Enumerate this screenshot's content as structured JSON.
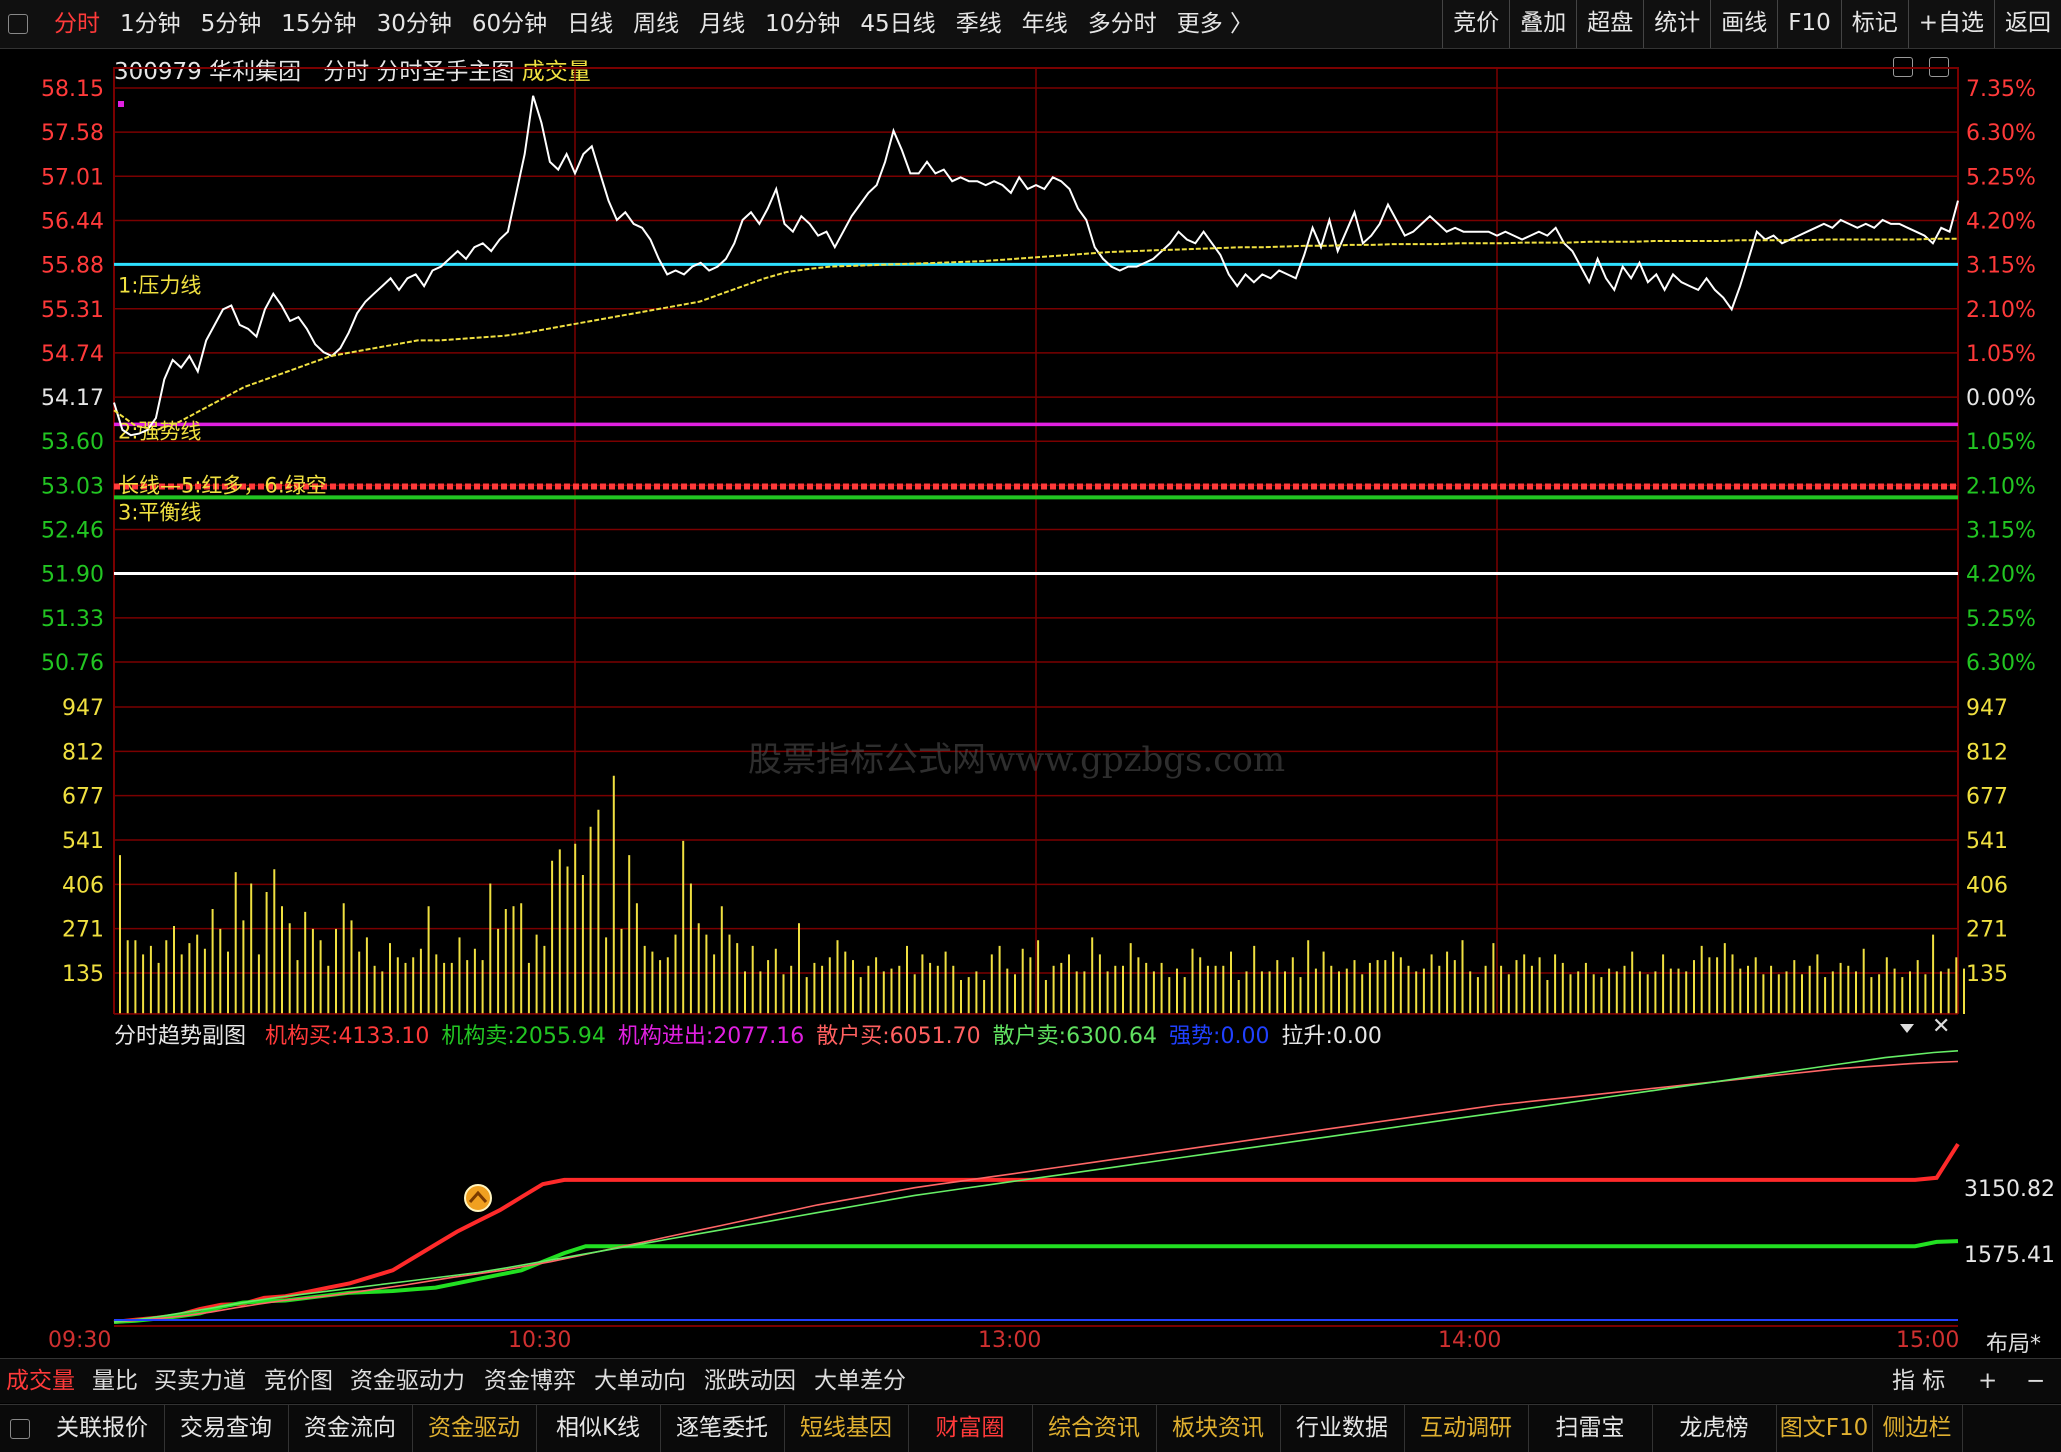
{
  "colors": {
    "up": "#ff3a3a",
    "down": "#22c522",
    "price_line": "#ffffff",
    "avg_line": "#f0e040",
    "pressure": "#2ee0ff",
    "strong": "#e020e0",
    "balance": "#22c522",
    "grid": "#7a0000",
    "volume": "#f0e040",
    "blue": "#2040ff"
  },
  "toolbar": {
    "tabs": [
      "分时",
      "1分钟",
      "5分钟",
      "15分钟",
      "30分钟",
      "60分钟",
      "日线",
      "周线",
      "月线",
      "10分钟",
      "45日线",
      "季线",
      "年线",
      "多分时",
      "更多 〉"
    ],
    "active_tab": "分时",
    "right_buttons": [
      "竞价",
      "叠加",
      "超盘",
      "统计",
      "画线",
      "F10",
      "标记",
      "+自选",
      "返回"
    ]
  },
  "header": {
    "code": "300979",
    "name": "华利集团",
    "view": "分时",
    "indicator": "分时圣手主图",
    "volume_label": "成交量"
  },
  "price_axis_left": [
    "58.15",
    "57.58",
    "57.01",
    "56.44",
    "55.88",
    "55.31",
    "54.74",
    "54.17",
    "53.60",
    "53.03",
    "52.46",
    "51.90",
    "51.33",
    "50.76"
  ],
  "pct_axis_right": [
    "7.35%",
    "6.30%",
    "5.25%",
    "4.20%",
    "3.15%",
    "2.10%",
    "1.05%",
    "0.00%",
    "1.05%",
    "2.10%",
    "3.15%",
    "4.20%",
    "5.25%",
    "6.30%"
  ],
  "volume_axis": [
    "947",
    "812",
    "677",
    "541",
    "406",
    "271",
    "135"
  ],
  "level_labels": {
    "pressure": "1:压力线",
    "strong": "2:强势线",
    "long": "长线—5:红多，6:绿空",
    "balance": "3:平衡线"
  },
  "chart_data": {
    "type": "line",
    "title": "",
    "x_ticks": [
      "09:30",
      "10:30",
      "13:00",
      "14:00",
      "15:00"
    ],
    "prev_close": 54.17,
    "ylim": [
      50.76,
      58.15
    ],
    "levels": {
      "pressure": 55.88,
      "strong": 53.82,
      "long": 53.02,
      "balance": 52.88,
      "white": 51.9
    },
    "series": [
      {
        "values": [
          54.1,
          53.75,
          53.68,
          53.7,
          53.75,
          53.9,
          54.4,
          54.65,
          54.55,
          54.7,
          54.5,
          54.9,
          55.1,
          55.3,
          55.35,
          55.1,
          55.05,
          54.95,
          55.3,
          55.5,
          55.35,
          55.15,
          55.2,
          55.05,
          54.85,
          54.75,
          54.7,
          54.8,
          55.0,
          55.25,
          55.4,
          55.5,
          55.6,
          55.7,
          55.55,
          55.7,
          55.75,
          55.6,
          55.8,
          55.85,
          55.95,
          56.05,
          55.95,
          56.1,
          56.15,
          56.05,
          56.2,
          56.3,
          56.8,
          57.3,
          58.05,
          57.7,
          57.2,
          57.1,
          57.3,
          57.05,
          57.3,
          57.4,
          57.05,
          56.7,
          56.45,
          56.55,
          56.4,
          56.35,
          56.2,
          55.95,
          55.75,
          55.8,
          55.75,
          55.85,
          55.9,
          55.8,
          55.85,
          55.95,
          56.15,
          56.45,
          56.55,
          56.4,
          56.6,
          56.85,
          56.4,
          56.3,
          56.5,
          56.4,
          56.25,
          56.3,
          56.1,
          56.3,
          56.5,
          56.65,
          56.8,
          56.9,
          57.2,
          57.6,
          57.35,
          57.05,
          57.05,
          57.2,
          57.05,
          57.1,
          56.95,
          57.0,
          56.95,
          56.95,
          56.9,
          56.95,
          56.9,
          56.8,
          57.0,
          56.85,
          56.9,
          56.85,
          57.0,
          56.95,
          56.85,
          56.6,
          56.45,
          56.1,
          55.95,
          55.85,
          55.8,
          55.85,
          55.85,
          55.9,
          55.95,
          56.05,
          56.15,
          56.3,
          56.2,
          56.15,
          56.3,
          56.15,
          56.0,
          55.75,
          55.6,
          55.75,
          55.65,
          55.75,
          55.7,
          55.8,
          55.75,
          55.7,
          56.0,
          56.35,
          56.1,
          56.45,
          56.05,
          56.3,
          56.55,
          56.15,
          56.25,
          56.4,
          56.65,
          56.45,
          56.25,
          56.3,
          56.4,
          56.5,
          56.4,
          56.3,
          56.35,
          56.3,
          56.3,
          56.3,
          56.3,
          56.25,
          56.3,
          56.25,
          56.2,
          56.25,
          56.3,
          56.25,
          56.35,
          56.15,
          56.05,
          55.85,
          55.65,
          55.95,
          55.7,
          55.55,
          55.85,
          55.7,
          55.9,
          55.65,
          55.75,
          55.55,
          55.75,
          55.65,
          55.6,
          55.55,
          55.7,
          55.55,
          55.45,
          55.3,
          55.6,
          55.95,
          56.3,
          56.2,
          56.25,
          56.15,
          56.2,
          56.25,
          56.3,
          56.35,
          56.4,
          56.35,
          56.45,
          56.4,
          56.35,
          56.4,
          56.35,
          56.45,
          56.4,
          56.4,
          56.35,
          56.3,
          56.25,
          56.15,
          56.35,
          56.3,
          56.7
        ]
      },
      {
        "values": [
          54.0,
          53.8,
          53.75,
          53.85,
          54.0,
          54.15,
          54.3,
          54.4,
          54.5,
          54.6,
          54.7,
          54.75,
          54.8,
          54.85,
          54.9,
          54.9,
          54.92,
          54.94,
          54.96,
          55.0,
          55.05,
          55.1,
          55.15,
          55.2,
          55.25,
          55.3,
          55.35,
          55.4,
          55.5,
          55.6,
          55.7,
          55.78,
          55.82,
          55.85,
          55.86,
          55.87,
          55.88,
          55.89,
          55.9,
          55.91,
          55.92,
          55.94,
          55.96,
          55.98,
          56.0,
          56.02,
          56.04,
          56.05,
          56.06,
          56.07,
          56.08,
          56.09,
          56.1,
          56.1,
          56.11,
          56.12,
          56.12,
          56.13,
          56.13,
          56.14,
          56.14,
          56.14,
          56.15,
          56.15,
          56.15,
          56.16,
          56.16,
          56.16,
          56.17,
          56.17,
          56.17,
          56.18,
          56.18,
          56.18,
          56.18,
          56.19,
          56.19,
          56.19,
          56.19,
          56.2,
          56.2,
          56.2,
          56.2,
          56.2,
          56.21,
          56.21
        ]
      }
    ],
    "volume": [
      560,
      260,
      260,
      210,
      240,
      180,
      260,
      310,
      210,
      250,
      280,
      230,
      370,
      300,
      220,
      500,
      330,
      460,
      210,
      430,
      510,
      380,
      320,
      190,
      360,
      300,
      260,
      170,
      300,
      390,
      330,
      220,
      270,
      170,
      150,
      250,
      200,
      180,
      200,
      230,
      380,
      210,
      180,
      180,
      270,
      190,
      230,
      190,
      460,
      300,
      370,
      380,
      390,
      180,
      280,
      240,
      540,
      580,
      520,
      600,
      490,
      660,
      720,
      270,
      840,
      300,
      560,
      390,
      240,
      220,
      190,
      200,
      280,
      610,
      460,
      320,
      280,
      210,
      380,
      280,
      250,
      150,
      240,
      150,
      190,
      230,
      140,
      170,
      320,
      130,
      180,
      170,
      200,
      260,
      220,
      190,
      130,
      170,
      200,
      150,
      160,
      170,
      240,
      140,
      210,
      180,
      170,
      220,
      170,
      120,
      130,
      150,
      120,
      210,
      240,
      160,
      140,
      230,
      200,
      260,
      120,
      170,
      180,
      210,
      150,
      150,
      270,
      210,
      150,
      170,
      170,
      250,
      200,
      180,
      150,
      180,
      130,
      160,
      130,
      230,
      200,
      170,
      170,
      170,
      220,
      120,
      150,
      240,
      150,
      150,
      190,
      150,
      200,
      130,
      260,
      160,
      220,
      170,
      150,
      160,
      190,
      140,
      180,
      190,
      190,
      220,
      200,
      170,
      150,
      160,
      210,
      170,
      220,
      190,
      260,
      150,
      130,
      170,
      250,
      170,
      140,
      190,
      210,
      170,
      200,
      120,
      210,
      180,
      140,
      150,
      180,
      140,
      130,
      160,
      150,
      170,
      220,
      150,
      140,
      150,
      210,
      160,
      160,
      150,
      190,
      240,
      200,
      200,
      250,
      210,
      160,
      170,
      200,
      140,
      170,
      140,
      150,
      190,
      140,
      170,
      210,
      130,
      150,
      180,
      170,
      150,
      230,
      130,
      140,
      200,
      160,
      130,
      150,
      190,
      140,
      280,
      150,
      160,
      200,
      160
    ]
  },
  "sub_chart": {
    "title": "分时趋势副图",
    "stats": [
      {
        "label": "机构买:",
        "value": "4133.10",
        "color": "#ff3a3a"
      },
      {
        "label": "机构卖:",
        "value": "2055.94",
        "color": "#22c522"
      },
      {
        "label": "机构进出:",
        "value": "2077.16",
        "color": "#e020e0"
      },
      {
        "label": "散户买:",
        "value": "6051.70",
        "color": "#ff6060"
      },
      {
        "label": "散户卖:",
        "value": "6300.64",
        "color": "#60e060"
      },
      {
        "label": "强势:",
        "value": "0.00",
        "color": "#2040ff"
      },
      {
        "label": "拉升:",
        "value": "0.00",
        "color": "#e6e6e6"
      }
    ],
    "axis": [
      "3150.82",
      "1575.41"
    ],
    "series": [
      {
        "name": "机构买",
        "values": [
          0,
          50,
          100,
          160,
          300,
          400,
          420,
          560,
          600,
          700,
          800,
          900,
          1050,
          1200,
          1500,
          1800,
          2100,
          2350,
          2600,
          2900,
          3200,
          3300,
          3300,
          3300,
          3300,
          3300,
          3300,
          3300,
          3300,
          3300,
          3300,
          3300,
          3300,
          3300,
          3300,
          3300,
          3300,
          3300,
          3300,
          3300,
          3300,
          3300,
          3300,
          3300,
          3300,
          3300,
          3300,
          3300,
          3300,
          3300,
          3300,
          3300,
          3300,
          3300,
          3300,
          3300,
          3300,
          3300,
          3300,
          3300,
          3300,
          3300,
          3300,
          3300,
          3300,
          3300,
          3300,
          3300,
          3300,
          3300,
          3300,
          3300,
          3300,
          3300,
          3300,
          3300,
          3300,
          3300,
          3300,
          3300,
          3300,
          3300,
          3300,
          3300,
          3300,
          3350,
          4133
        ]
      },
      {
        "name": "机构卖",
        "values": [
          0,
          30,
          80,
          130,
          200,
          350,
          450,
          480,
          500,
          560,
          620,
          680,
          700,
          720,
          760,
          800,
          900,
          1000,
          1100,
          1200,
          1400,
          1600,
          1760,
          1760,
          1760,
          1760,
          1760,
          1760,
          1760,
          1760,
          1760,
          1760,
          1760,
          1760,
          1760,
          1760,
          1760,
          1760,
          1760,
          1760,
          1760,
          1760,
          1760,
          1760,
          1760,
          1760,
          1760,
          1760,
          1760,
          1760,
          1760,
          1760,
          1760,
          1760,
          1760,
          1760,
          1760,
          1760,
          1760,
          1760,
          1760,
          1760,
          1760,
          1760,
          1760,
          1760,
          1760,
          1760,
          1760,
          1760,
          1760,
          1760,
          1760,
          1760,
          1760,
          1760,
          1760,
          1760,
          1760,
          1760,
          1760,
          1760,
          1760,
          1760,
          1760,
          1860,
          1880
        ]
      },
      {
        "name": "散户买",
        "values": [
          0,
          40,
          90,
          150,
          230,
          330,
          420,
          500,
          560,
          620,
          700,
          780,
          860,
          950,
          1040,
          1120,
          1200,
          1300,
          1400,
          1520,
          1640,
          1760,
          1880,
          2000,
          2120,
          2240,
          2360,
          2480,
          2600,
          2720,
          2820,
          2920,
          3020,
          3120,
          3200,
          3280,
          3360,
          3440,
          3520,
          3600,
          3680,
          3760,
          3840,
          3920,
          4000,
          4080,
          4160,
          4240,
          4320,
          4400,
          4480,
          4560,
          4640,
          4720,
          4800,
          4880,
          4960,
          5040,
          5100,
          5160,
          5220,
          5280,
          5340,
          5400,
          5460,
          5520,
          5580,
          5640,
          5700,
          5760,
          5820,
          5880,
          5920,
          5960,
          6000,
          6030,
          6051
        ]
      },
      {
        "name": "散户卖",
        "values": [
          0,
          60,
          140,
          230,
          320,
          420,
          510,
          590,
          660,
          730,
          800,
          870,
          940,
          1010,
          1080,
          1150,
          1240,
          1340,
          1440,
          1540,
          1640,
          1740,
          1840,
          1940,
          2040,
          2140,
          2240,
          2340,
          2440,
          2540,
          2640,
          2740,
          2840,
          2940,
          3020,
          3100,
          3180,
          3260,
          3340,
          3420,
          3500,
          3580,
          3660,
          3740,
          3820,
          3900,
          3980,
          4060,
          4140,
          4220,
          4300,
          4380,
          4460,
          4540,
          4620,
          4700,
          4780,
          4860,
          4940,
          5020,
          5100,
          5180,
          5260,
          5340,
          5420,
          5500,
          5580,
          5660,
          5740,
          5820,
          5900,
          5980,
          6060,
          6140,
          6200,
          6260,
          6300
        ]
      }
    ]
  },
  "bottom_tabs": [
    "成交量",
    "量比",
    "买卖力道",
    "竞价图",
    "资金驱动力",
    "资金博弈",
    "大单动向",
    "涨跌动因",
    "大单差分"
  ],
  "bottom_tabs_active": "成交量",
  "bottom_tabs_right": [
    "指 标",
    "+",
    "−"
  ],
  "layout_label": "布局*",
  "bottom_nav": [
    {
      "label": "关联报价",
      "color": "#e6e6e6"
    },
    {
      "label": "交易查询",
      "color": "#e6e6e6"
    },
    {
      "label": "资金流向",
      "color": "#e6e6e6"
    },
    {
      "label": "资金驱动",
      "color": "#e0b030"
    },
    {
      "label": "相似K线",
      "color": "#e6e6e6"
    },
    {
      "label": "逐笔委托",
      "color": "#e6e6e6"
    },
    {
      "label": "短线基因",
      "color": "#e0b030"
    },
    {
      "label": "财富圈",
      "color": "#ff3a3a"
    },
    {
      "label": "综合资讯",
      "color": "#e0b030"
    },
    {
      "label": "板块资讯",
      "color": "#e0b030"
    },
    {
      "label": "行业数据",
      "color": "#e6e6e6"
    },
    {
      "label": "互动调研",
      "color": "#e0b030"
    },
    {
      "label": "扫雷宝",
      "color": "#e6e6e6"
    },
    {
      "label": "龙虎榜",
      "color": "#e6e6e6"
    },
    {
      "label": "图文F10",
      "color": "#e0b030"
    },
    {
      "label": "侧边栏",
      "color": "#e0b030"
    }
  ],
  "watermark": "股票指标公式网www.gpzbgs.com"
}
